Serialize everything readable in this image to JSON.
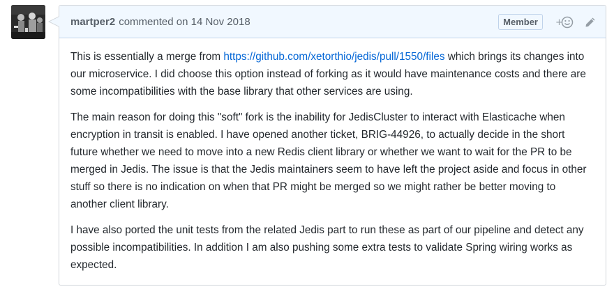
{
  "comment": {
    "author": "martper2",
    "action_text": "commented on",
    "date": "14 Nov 2018",
    "role_badge": "Member",
    "icons": {
      "avatar": "user-avatar",
      "reaction": "add-reaction-smiley-icon",
      "edit": "pencil-icon"
    },
    "colors": {
      "header_bg": "#f1f8ff",
      "border": "#d1d5da",
      "link": "#0366d6",
      "text": "#24292e",
      "muted": "#586069"
    },
    "paragraphs": [
      {
        "before_link": "This is essentially a merge from ",
        "link": "https://github.com/xetorthio/jedis/pull/1550/files",
        "after_link": " which brings its changes into our microservice. I did choose this option instead of forking as it would have maintenance costs and there are some incompatibilities with the base library that other services are using."
      },
      {
        "text": "The main reason for doing this \"soft\" fork is the inability for JedisCluster to interact with Elasticache when encryption in transit is enabled. I have opened another ticket, BRIG-44926, to actually decide in the short future whether we need to move into a new Redis client library or whether we want to wait for the PR to be merged in Jedis. The issue is that the Jedis maintainers seem to have left the project aside and focus in other stuff so there is no indication on when that PR might be merged so we might rather be better moving to another client library."
      },
      {
        "text": "I have also ported the unit tests from the related Jedis part to run these as part of our pipeline and detect any possible incompatibilities. In addition I am also pushing some extra tests to validate Spring wiring works as expected."
      }
    ]
  }
}
